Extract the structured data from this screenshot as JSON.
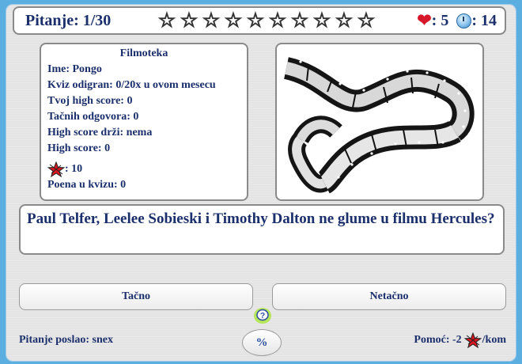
{
  "header": {
    "question_label": "Pitanje: 1/30",
    "stars_total": 10,
    "stars_filled": 0,
    "lives": ": 5",
    "time": ": 14",
    "lives_icon": "heart-icon",
    "time_icon": "clock-icon"
  },
  "info": {
    "title": "Filmoteka",
    "name": "Ime: Pongo",
    "played": "Kviz odigran: 0/20x u ovom mesecu",
    "your_high_score": "Tvoj high score: 0",
    "correct": "Tačnih odgovora: 0",
    "high_score_holder": "High score drži: nema",
    "high_score": "High score: 0",
    "bonus": ": 10",
    "bonus_icon": "red-star-icon",
    "points": "Poena u kvizu: 0"
  },
  "image": {
    "icon": "film-strip-image"
  },
  "question": {
    "text": "Paul Telfer, Leelee Sobieski i Timothy Dalton ne glume u filmu Hercules?"
  },
  "answers": {
    "true_label": "Tačno",
    "false_label": "Netačno"
  },
  "footer": {
    "sender": "Pitanje poslao: snex",
    "percent_label": "%",
    "help_prefix": "Pomoć: -2",
    "help_suffix": "/kom",
    "help_icon": "question-badge-icon"
  },
  "colors": {
    "text": "#1a2f6b",
    "background": "#5aaee0",
    "heart": "#d7182a",
    "bonus_star": "#d9151f"
  }
}
